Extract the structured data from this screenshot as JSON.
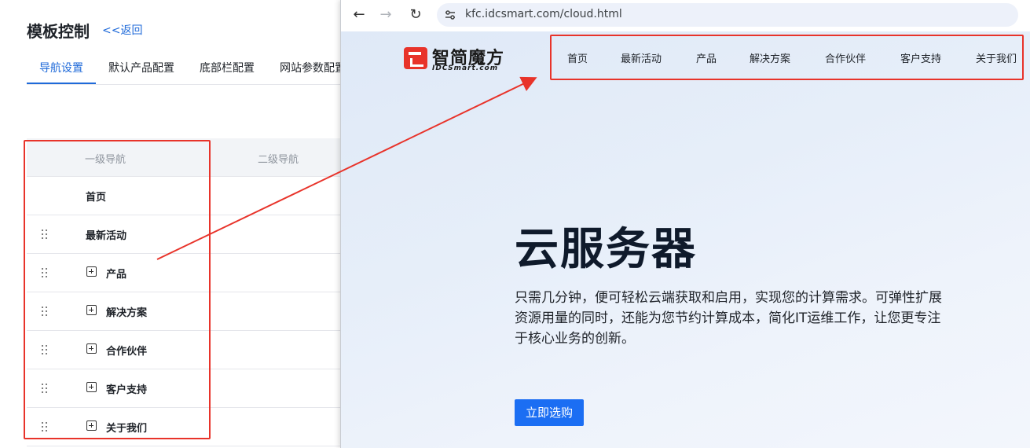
{
  "admin": {
    "title": "模板控制",
    "back_label": "<<返回",
    "tabs": [
      {
        "label": "导航设置",
        "active": true
      },
      {
        "label": "默认产品配置",
        "active": false
      },
      {
        "label": "底部栏配置",
        "active": false
      },
      {
        "label": "网站参数配置",
        "active": false
      }
    ],
    "table": {
      "headers": [
        "一级导航",
        "二级导航"
      ],
      "rows": [
        {
          "label": "首页",
          "draggable": false,
          "expandable": false
        },
        {
          "label": "最新活动",
          "draggable": true,
          "expandable": false
        },
        {
          "label": "产品",
          "draggable": true,
          "expandable": true
        },
        {
          "label": "解决方案",
          "draggable": true,
          "expandable": true
        },
        {
          "label": "合作伙伴",
          "draggable": true,
          "expandable": true
        },
        {
          "label": "客户支持",
          "draggable": true,
          "expandable": true
        },
        {
          "label": "关于我们",
          "draggable": true,
          "expandable": true
        }
      ]
    }
  },
  "browser": {
    "url": "kfc.idcsmart.com/cloud.html",
    "logo_cn": "智简魔方",
    "logo_en": "IDCSmart.com",
    "nav": [
      "首页",
      "最新活动",
      "产品",
      "解决方案",
      "合作伙伴",
      "客户支持",
      "关于我们"
    ],
    "hero": {
      "title": "云服务器",
      "description": "只需几分钟，便可轻松云端获取和启用，实现您的计算需求。可弹性扩展资源用量的同时，还能为您节约计算成本，简化IT运维工作，让您更专注于核心业务的创新。",
      "button": "立即选购"
    }
  },
  "colors": {
    "accent": "#1f6ad9",
    "annotation_red": "#e8332a",
    "hero_button": "#1b6ef3"
  }
}
